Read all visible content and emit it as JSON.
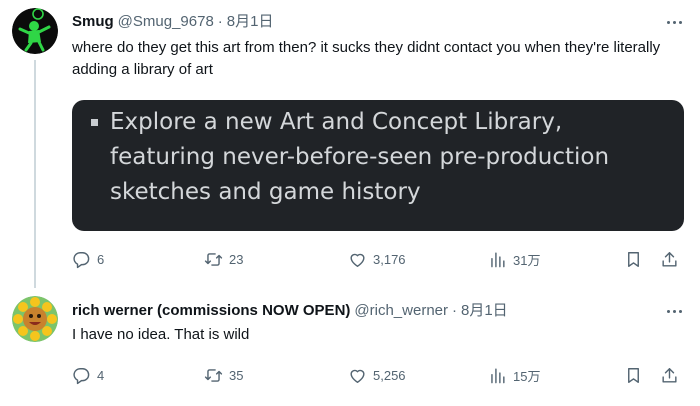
{
  "tweets": [
    {
      "author": {
        "name": "Smug",
        "handle": "@Smug_9678",
        "date": "8月1日"
      },
      "text": "where do they get this art from then? it sucks they didnt contact you when they're literally adding a library of art",
      "media": {
        "text": "Explore a new Art and Concept Library, featuring never-before-seen pre-production sketches and game history"
      },
      "stats": {
        "replies": "6",
        "retweets": "23",
        "likes": "3,176",
        "views": "31万"
      }
    },
    {
      "author": {
        "name": "rich werner (commissions NOW OPEN)",
        "handle": "@rich_werner",
        "date": "8月1日"
      },
      "text": "I have no idea. That is wild",
      "stats": {
        "replies": "4",
        "retweets": "35",
        "likes": "5,256",
        "views": "15万"
      }
    }
  ],
  "separator": "·",
  "colors": {
    "text": "#0f1419",
    "secondary": "#536471",
    "media_bg": "#202327",
    "thread_line": "#cfd9de"
  },
  "icons": [
    "reply-icon",
    "retweet-icon",
    "like-icon",
    "views-icon",
    "bookmark-icon",
    "share-icon",
    "more-icon"
  ]
}
